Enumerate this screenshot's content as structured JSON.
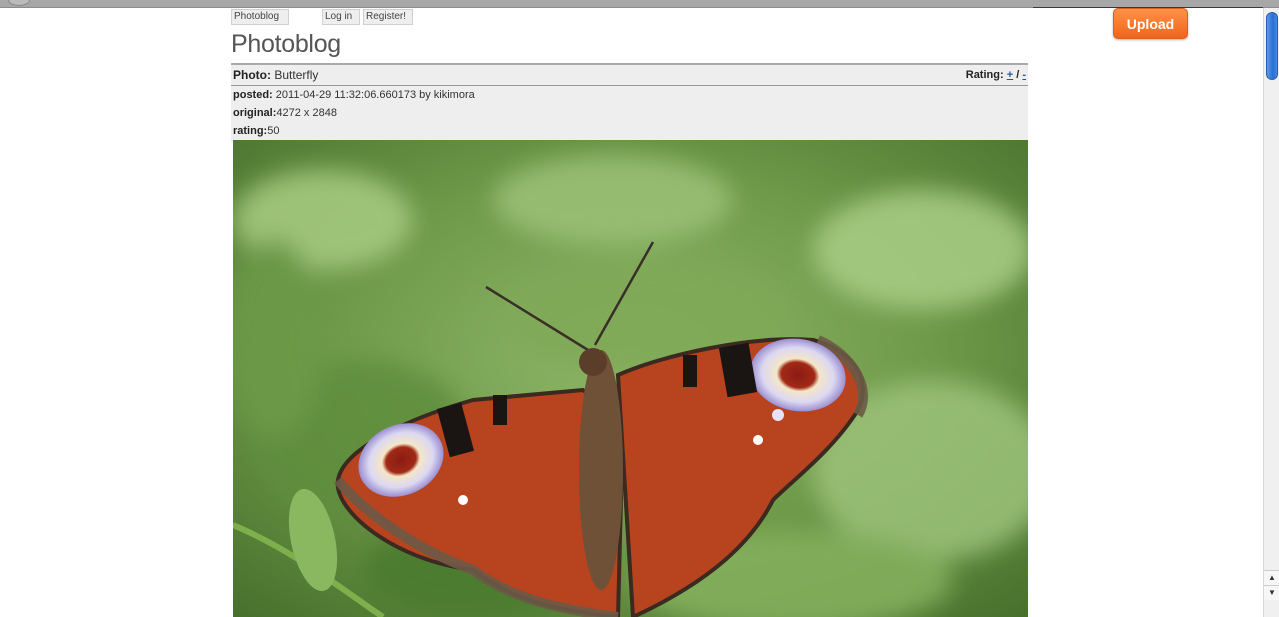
{
  "nav": {
    "home_label": "Photoblog",
    "login_label": "Log in",
    "register_label": "Register!"
  },
  "upload_label": "Upload",
  "page_title": "Photoblog",
  "photo": {
    "label": "Photo:",
    "title": "Butterfly",
    "rating_label": "Rating:",
    "rate_up": "+",
    "rate_separator": "/",
    "rate_down": "-",
    "posted_label": "posted:",
    "posted_value": "2011-04-29 11:32:06.660173 by kikimora",
    "original_label": "original:",
    "original_value": "4272 x 2848",
    "rating_field_label": "rating:",
    "rating_value": "50"
  },
  "icons": {
    "scroll_up": "triangle-up-icon",
    "scroll_down": "triangle-down-icon"
  },
  "colors": {
    "upload_button": "#f47a2c",
    "header_background": "#eeeeee",
    "link_blue": "#2255aa"
  }
}
